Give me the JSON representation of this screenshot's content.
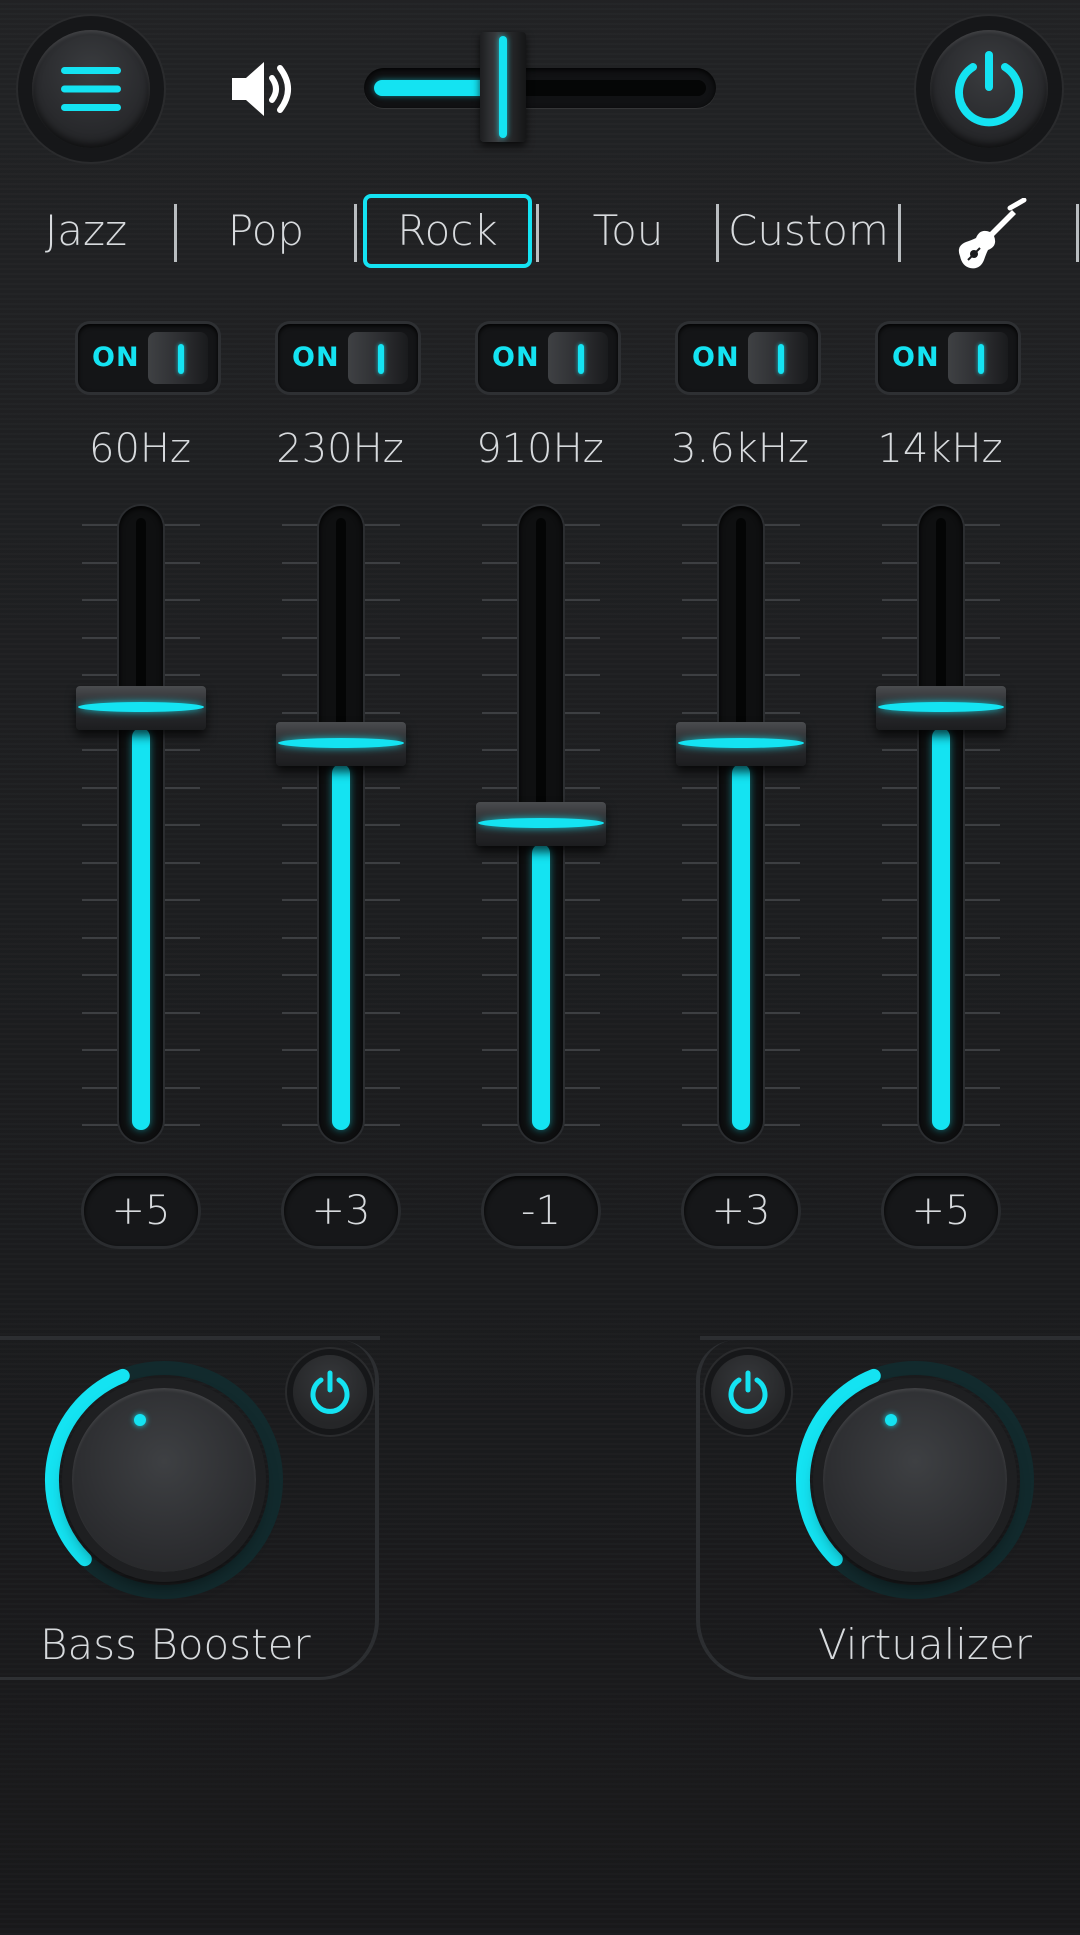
{
  "colors": {
    "accent": "#14e3f2",
    "background": "#1b1c1e",
    "text": "#d7dadd"
  },
  "top_bar": {
    "menu_icon": "hamburger-menu-icon",
    "volume_icon": "speaker-volume-icon",
    "volume_level": 0.39,
    "power_icon": "power-icon"
  },
  "presets": {
    "items": [
      {
        "label": "Jazz",
        "active": false
      },
      {
        "label": "Pop",
        "active": false
      },
      {
        "label": "Rock",
        "active": true
      },
      {
        "label": "Tou",
        "active": false
      },
      {
        "label": "Custom",
        "active": false
      }
    ],
    "extra_icon": "guitar-icon"
  },
  "bands": [
    {
      "toggle": "ON",
      "freq": "60Hz",
      "value": "+5",
      "level": 0.69
    },
    {
      "toggle": "ON",
      "freq": "230Hz",
      "value": "+3",
      "level": 0.63
    },
    {
      "toggle": "ON",
      "freq": "910Hz",
      "value": "-1",
      "level": 0.5
    },
    {
      "toggle": "ON",
      "freq": "3.6kHz",
      "value": "+3",
      "level": 0.63
    },
    {
      "toggle": "ON",
      "freq": "14kHz",
      "value": "+5",
      "level": 0.69
    }
  ],
  "effects": {
    "bass": {
      "label": "Bass Booster",
      "level": 0.42
    },
    "virtualizer": {
      "label": "Virtualizer",
      "level": 0.42
    }
  }
}
